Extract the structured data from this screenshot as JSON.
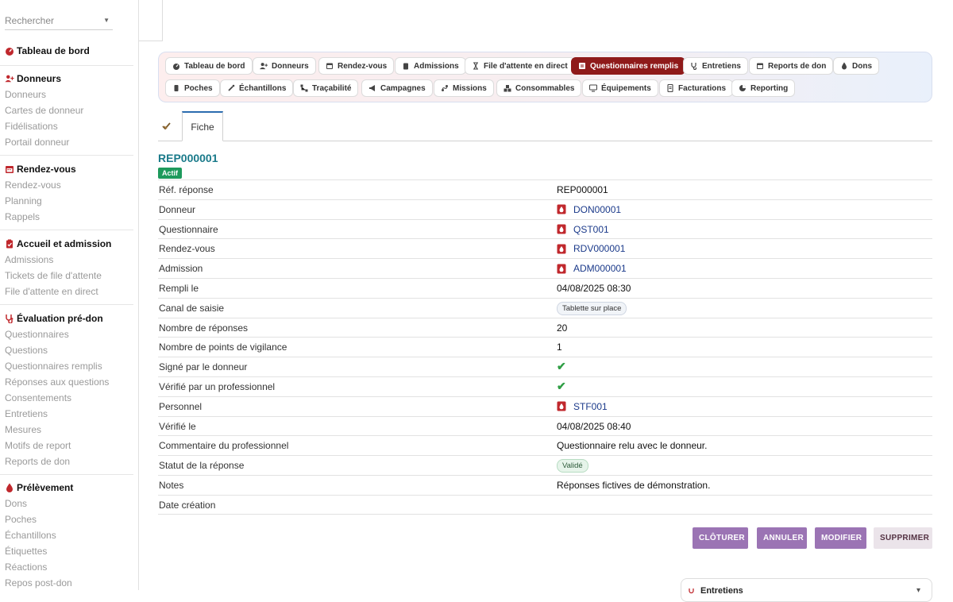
{
  "sidebar": {
    "search_placeholder": "Rechercher",
    "dashboard": "Tableau de bord",
    "sections": [
      {
        "title": "Donneurs",
        "items": [
          "Donneurs",
          "Cartes de donneur",
          "Fidélisations",
          "Portail donneur"
        ]
      },
      {
        "title": "Rendez-vous",
        "items": [
          "Rendez-vous",
          "Planning",
          "Rappels"
        ]
      },
      {
        "title": "Accueil et admission",
        "items": [
          "Admissions",
          "Tickets de file d'attente",
          "File d'attente en direct"
        ]
      },
      {
        "title": "Évaluation pré-don",
        "items": [
          "Questionnaires",
          "Questions",
          "Questionnaires remplis",
          "Réponses aux questions",
          "Consentements",
          "Entretiens",
          "Mesures",
          "Motifs de report",
          "Reports de don"
        ]
      },
      {
        "title": "Prélèvement",
        "items": [
          "Dons",
          "Poches",
          "Échantillons",
          "Étiquettes",
          "Réactions",
          "Repos post-don"
        ]
      }
    ]
  },
  "modnav": {
    "pills": [
      "Tableau de bord",
      "Donneurs",
      "Rendez-vous",
      "Admissions",
      "File d'attente en direct",
      "Questionnaires remplis",
      "Entretiens",
      "Reports de don",
      "Dons",
      "Poches",
      "Échantillons",
      "Traçabilité",
      "Campagnes",
      "Missions",
      "Consommables",
      "Équipements",
      "Facturations",
      "Reporting"
    ],
    "active": "Questionnaires remplis"
  },
  "tabs": {
    "fiche": "Fiche"
  },
  "record": {
    "title": "REP000001",
    "status_badge": "Actif",
    "rows": [
      {
        "label": "Réf. réponse",
        "value": "REP000001"
      },
      {
        "label": "Donneur",
        "value": "DON00001"
      },
      {
        "label": "Questionnaire",
        "value": "QST001"
      },
      {
        "label": "Rendez-vous",
        "value": "RDV000001"
      },
      {
        "label": "Admission",
        "value": "ADM000001"
      },
      {
        "label": "Rempli le",
        "value": "04/08/2025 08:30"
      },
      {
        "label": "Canal de saisie",
        "value": "Tablette sur place"
      },
      {
        "label": "Nombre de réponses",
        "value": "20"
      },
      {
        "label": "Nombre de points de vigilance",
        "value": "1"
      },
      {
        "label": "Signé par le donneur",
        "value": "✔"
      },
      {
        "label": "Vérifié par un professionnel",
        "value": "✔"
      },
      {
        "label": "Personnel",
        "value": "STF001"
      },
      {
        "label": "Vérifié le",
        "value": "04/08/2025 08:40"
      },
      {
        "label": "Commentaire du professionnel",
        "value": "Questionnaire relu avec le donneur."
      },
      {
        "label": "Statut de la réponse",
        "value": "Validé"
      },
      {
        "label": "Notes",
        "value": "Réponses fictives de démonstration."
      },
      {
        "label": "Date création",
        "value": ""
      }
    ]
  },
  "actions": {
    "close": "CLÔTURER",
    "cancel": "ANNULER",
    "edit": "MODIFIER",
    "delete": "SUPPRIMER"
  },
  "bottom_panel": {
    "title": "Entretiens"
  },
  "colors": {
    "accent_red": "#8f1a1a",
    "link_blue": "#1b3a8a",
    "teal_title": "#1a7a8a",
    "action_purple": "#9b74b4"
  }
}
